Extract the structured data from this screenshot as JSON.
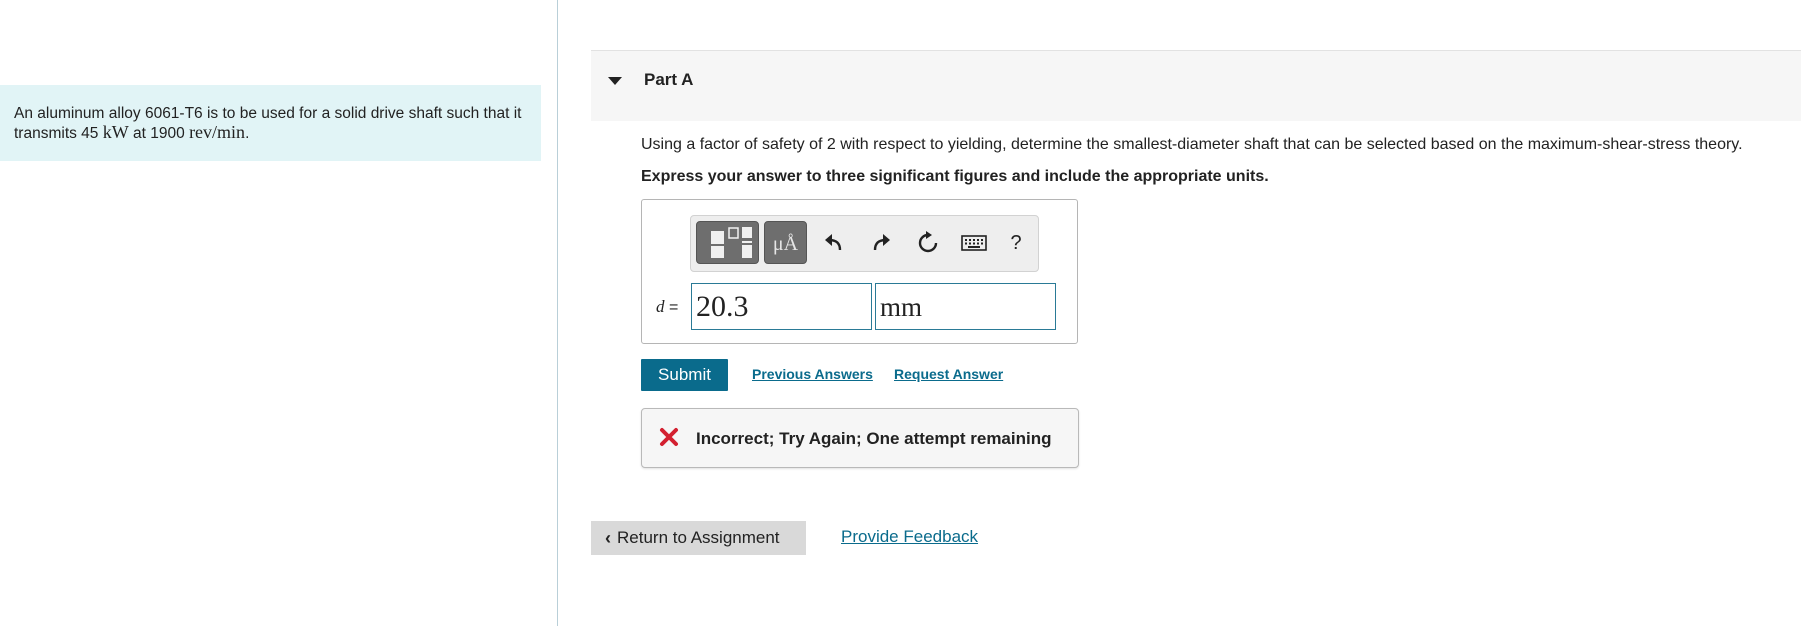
{
  "problem": {
    "text_part1": "An aluminum alloy 6061-T6 is to be used for a solid drive shaft such that it transmits 45 ",
    "unit_power": "kW",
    "text_part2": " at 1900 ",
    "unit_speed": "rev/min",
    "text_end": "."
  },
  "part": {
    "title": "Part A",
    "question": "Using a factor of safety of 2 with respect to yielding, determine the smallest-diameter shaft that can be selected based on the maximum-shear-stress theory.",
    "instruction": "Express your answer to three significant figures and include the appropriate units."
  },
  "toolbar": {
    "template_icon": "templates-icon",
    "units_label": "μÅ",
    "undo_icon": "undo-icon",
    "redo_icon": "redo-icon",
    "reset_icon": "reset-icon",
    "keyboard_icon": "keyboard-icon",
    "help_label": "?"
  },
  "answer": {
    "variable": "d",
    "equals": "=",
    "value": "20.3",
    "unit": "mm"
  },
  "actions": {
    "submit_label": "Submit",
    "previous_answers_label": "Previous Answers",
    "request_answer_label": "Request Answer"
  },
  "feedback": {
    "status_icon": "x-icon",
    "message": "Incorrect; Try Again; One attempt remaining"
  },
  "footer": {
    "return_label": "Return to Assignment",
    "provide_feedback_label": "Provide Feedback"
  },
  "colors": {
    "accent": "#0a6b8c",
    "problem_bg": "#e1f4f6",
    "error": "#d32030"
  }
}
